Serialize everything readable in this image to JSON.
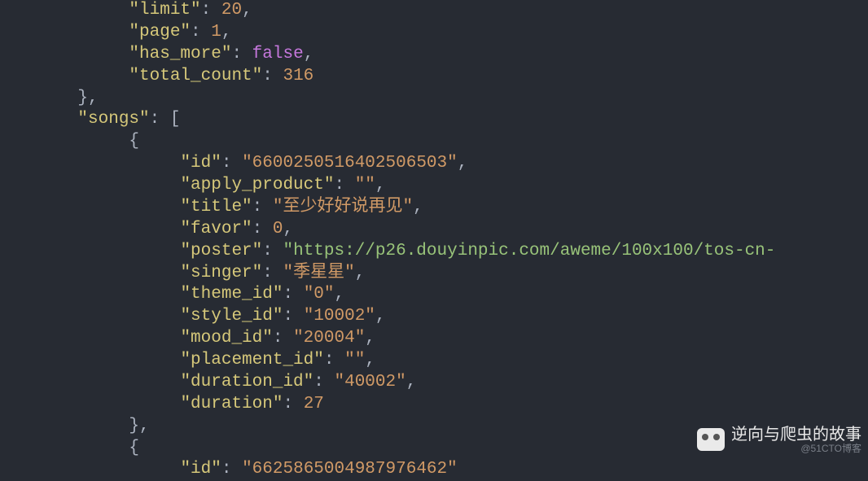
{
  "code": {
    "pagination": {
      "limit_key": "\"limit\"",
      "limit_val": "20",
      "page_key": "\"page\"",
      "page_val": "1",
      "has_more_key": "\"has_more\"",
      "has_more_val": "false",
      "total_count_key": "\"total_count\"",
      "total_count_val": "316"
    },
    "songs_key": "\"songs\"",
    "song1": {
      "id_key": "\"id\"",
      "id_val": "\"6600250516402506503\"",
      "apply_product_key": "\"apply_product\"",
      "apply_product_val": "\"\"",
      "title_key": "\"title\"",
      "title_val": "\"至少好好说再见\"",
      "favor_key": "\"favor\"",
      "favor_val": "0",
      "poster_key": "\"poster\"",
      "poster_val": "\"https://p26.douyinpic.com/aweme/100x100/tos-cn-",
      "singer_key": "\"singer\"",
      "singer_val": "\"季星星\"",
      "theme_id_key": "\"theme_id\"",
      "theme_id_val": "\"0\"",
      "style_id_key": "\"style_id\"",
      "style_id_val": "\"10002\"",
      "mood_id_key": "\"mood_id\"",
      "mood_id_val": "\"20004\"",
      "placement_id_key": "\"placement_id\"",
      "placement_id_val": "\"\"",
      "duration_id_key": "\"duration_id\"",
      "duration_id_val": "\"40002\"",
      "duration_key": "\"duration\"",
      "duration_val": "27"
    },
    "song2": {
      "id_key": "\"id\"",
      "id_val": "\"6625865004987976462\""
    }
  },
  "watermark": {
    "title": "逆向与爬虫的故事",
    "sub": "@51CTO博客"
  }
}
